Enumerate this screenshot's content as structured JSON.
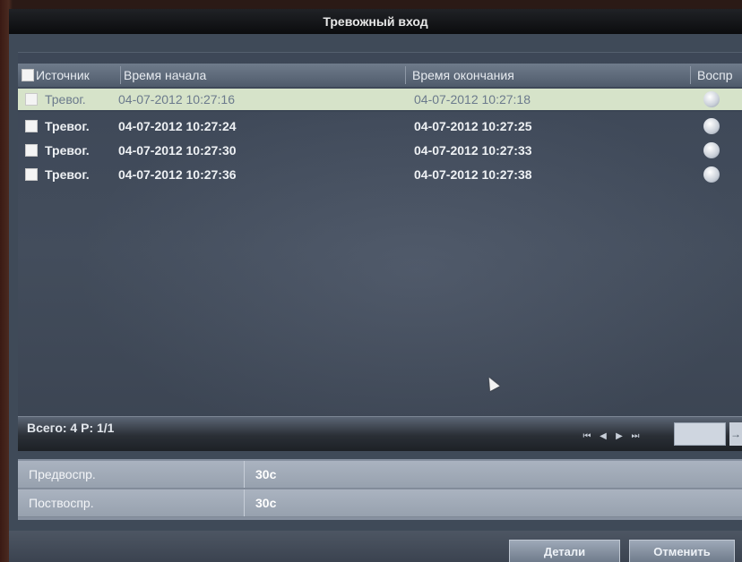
{
  "window": {
    "title": "Тревожный вход"
  },
  "table": {
    "headers": {
      "source": "Источник",
      "start": "Время начала",
      "end": "Время окончания",
      "play": "Воспр"
    },
    "rows": [
      {
        "source": "Тревог.",
        "start": "04-07-2012 10:27:16",
        "end": "04-07-2012 10:27:18",
        "selected": true
      },
      {
        "source": "Тревог.",
        "start": "04-07-2012 10:27:24",
        "end": "04-07-2012 10:27:25",
        "selected": false
      },
      {
        "source": "Тревог.",
        "start": "04-07-2012 10:27:30",
        "end": "04-07-2012 10:27:33",
        "selected": false
      },
      {
        "source": "Тревог.",
        "start": "04-07-2012 10:27:36",
        "end": "04-07-2012 10:27:38",
        "selected": false
      }
    ]
  },
  "status": {
    "summary": "Всего: 4  P: 1/1"
  },
  "pagination": {
    "first": "⏮",
    "prev": "◀",
    "next": "▶",
    "last": "⏭",
    "go": "→"
  },
  "settings": {
    "pre": {
      "label": "Предвоспр.",
      "value": "30с"
    },
    "post": {
      "label": "Поствоспр.",
      "value": "30с"
    }
  },
  "buttons": {
    "details": "Детали",
    "cancel": "Отменить"
  },
  "colors": {
    "selected_row": "#d6e3c9",
    "panel": "#3f4a58"
  }
}
